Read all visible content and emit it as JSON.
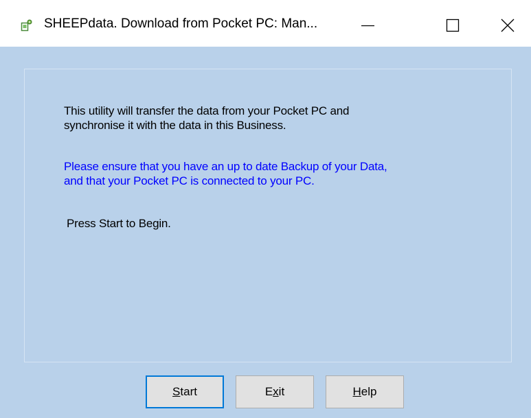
{
  "window": {
    "title": "SHEEPdata. Download from Pocket PC: Man...",
    "icon": "app-icon",
    "controls": {
      "minimize": "minimize-icon",
      "maximize": "maximize-icon",
      "close": "close-icon"
    }
  },
  "content": {
    "intro_lines": [
      "This utility will transfer the data from your Pocket PC and",
      "synchronise it with the data in this Business."
    ],
    "warning_lines": [
      "Please ensure that you have an up to date Backup of your Data,",
      "and that your Pocket PC is connected to your PC."
    ],
    "prompt": "Press Start to Begin."
  },
  "buttons": {
    "start": {
      "mnemonic": "S",
      "rest": "tart"
    },
    "exit": {
      "pre": "E",
      "mnemonic": "x",
      "rest": "it"
    },
    "help": {
      "mnemonic": "H",
      "rest": "elp"
    }
  },
  "colors": {
    "window_background": "#b9d1ea",
    "warning_text": "#0000ff",
    "default_button_border": "#0078d7"
  }
}
